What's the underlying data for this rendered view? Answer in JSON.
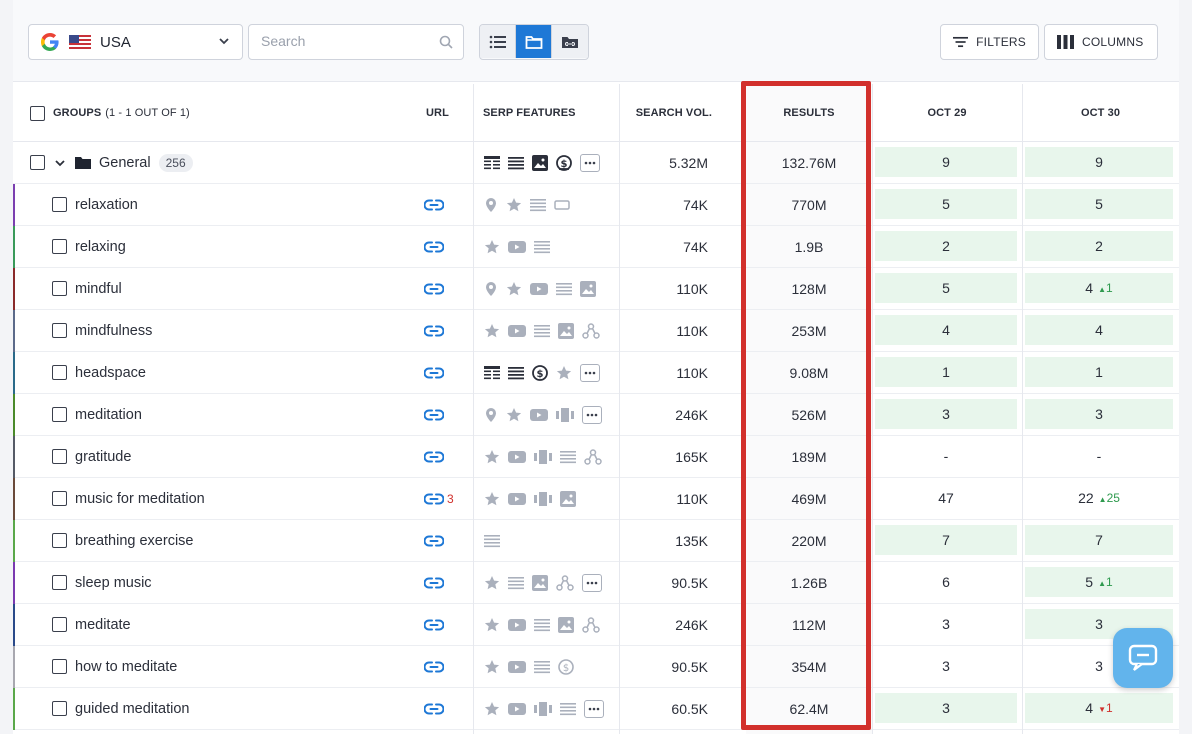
{
  "toolbar": {
    "country": "USA",
    "search_placeholder": "Search",
    "filters_label": "FILTERS",
    "columns_label": "COLUMNS"
  },
  "columns": {
    "groups": "GROUPS",
    "groups_count": "(1 - 1 OUT OF 1)",
    "url": "URL",
    "serp": "SERP FEATURES",
    "volume": "SEARCH VOL.",
    "results": "RESULTS",
    "date1": "OCT 29",
    "date2": "OCT 30"
  },
  "group": {
    "name": "General",
    "count": "256",
    "serp": [
      "table-icon",
      "list-icon",
      "image-icon",
      "dollar-icon",
      "more"
    ],
    "volume": "5.32M",
    "results": "132.76M",
    "oct29": "9",
    "oct30": "9"
  },
  "rows": [
    {
      "keyword": "relaxation",
      "stripe": "#7b3fb0",
      "url_count": "",
      "serp": [
        "pin",
        "star",
        "list",
        "box"
      ],
      "volume": "74K",
      "results": "770M",
      "oct29": "5",
      "oct30": "5",
      "oct30_delta": "",
      "oct30_dir": "",
      "g29": true,
      "g30": true
    },
    {
      "keyword": "relaxing",
      "stripe": "#3a9a5a",
      "url_count": "",
      "serp": [
        "star",
        "video",
        "list"
      ],
      "volume": "74K",
      "results": "1.9B",
      "oct29": "2",
      "oct30": "2",
      "oct30_delta": "",
      "oct30_dir": "",
      "g29": true,
      "g30": true
    },
    {
      "keyword": "mindful",
      "stripe": "#8a2a2a",
      "url_count": "",
      "serp": [
        "pin",
        "star",
        "video",
        "list",
        "image"
      ],
      "volume": "110K",
      "results": "128M",
      "oct29": "5",
      "oct30": "4",
      "oct30_delta": "1",
      "oct30_dir": "up",
      "g29": true,
      "g30": true
    },
    {
      "keyword": "mindfulness",
      "stripe": "#5c6a8a",
      "url_count": "",
      "serp": [
        "star",
        "video",
        "list",
        "image",
        "tree"
      ],
      "volume": "110K",
      "results": "253M",
      "oct29": "4",
      "oct30": "4",
      "oct30_delta": "",
      "oct30_dir": "",
      "g29": true,
      "g30": true
    },
    {
      "keyword": "headspace",
      "stripe": "#2a6a8a",
      "url_count": "",
      "serp": [
        "table-dark",
        "list-dark",
        "dollar-dark",
        "star",
        "more"
      ],
      "volume": "110K",
      "results": "9.08M",
      "oct29": "1",
      "oct30": "1",
      "oct30_delta": "",
      "oct30_dir": "",
      "g29": true,
      "g30": true
    },
    {
      "keyword": "meditation",
      "stripe": "#4a8a2a",
      "url_count": "",
      "serp": [
        "pin",
        "star",
        "video",
        "carousel",
        "more"
      ],
      "volume": "246K",
      "results": "526M",
      "oct29": "3",
      "oct30": "3",
      "oct30_delta": "",
      "oct30_dir": "",
      "g29": true,
      "g30": true
    },
    {
      "keyword": "gratitude",
      "stripe": "#555a66",
      "url_count": "",
      "serp": [
        "star",
        "video",
        "carousel",
        "list",
        "tree"
      ],
      "volume": "165K",
      "results": "189M",
      "oct29": "-",
      "oct30": "-",
      "oct30_delta": "",
      "oct30_dir": "",
      "g29": false,
      "g30": false
    },
    {
      "keyword": "music for meditation",
      "stripe": "#6a4a3a",
      "url_count": "3",
      "serp": [
        "star",
        "video",
        "carousel",
        "image"
      ],
      "volume": "110K",
      "results": "469M",
      "oct29": "47",
      "oct30": "22",
      "oct30_delta": "25",
      "oct30_dir": "up",
      "g29": false,
      "g30": false
    },
    {
      "keyword": "breathing exercise",
      "stripe": "#5aa84a",
      "url_count": "",
      "serp": [
        "list"
      ],
      "volume": "135K",
      "results": "220M",
      "oct29": "7",
      "oct30": "7",
      "oct30_delta": "",
      "oct30_dir": "",
      "g29": true,
      "g30": true
    },
    {
      "keyword": "sleep music",
      "stripe": "#7a3ab0",
      "url_count": "",
      "serp": [
        "star",
        "list",
        "image",
        "tree",
        "more"
      ],
      "volume": "90.5K",
      "results": "1.26B",
      "oct29": "6",
      "oct30": "5",
      "oct30_delta": "1",
      "oct30_dir": "up",
      "g29": false,
      "g30": true
    },
    {
      "keyword": "meditate",
      "stripe": "#2a4a8a",
      "url_count": "",
      "serp": [
        "star",
        "video",
        "list",
        "image",
        "tree"
      ],
      "volume": "246K",
      "results": "112M",
      "oct29": "3",
      "oct30": "3",
      "oct30_delta": "",
      "oct30_dir": "",
      "g29": false,
      "g30": true
    },
    {
      "keyword": "how to meditate",
      "stripe": "#a8a8b0",
      "url_count": "",
      "serp": [
        "star",
        "video",
        "list",
        "dollar"
      ],
      "volume": "90.5K",
      "results": "354M",
      "oct29": "3",
      "oct30": "3",
      "oct30_delta": "",
      "oct30_dir": "",
      "g29": false,
      "g30": false
    },
    {
      "keyword": "guided meditation",
      "stripe": "#5aa84a",
      "url_count": "",
      "serp": [
        "star",
        "video",
        "carousel",
        "list",
        "more"
      ],
      "volume": "60.5K",
      "results": "62.4M",
      "oct29": "3",
      "oct30": "4",
      "oct30_delta": "1",
      "oct30_dir": "down",
      "g29": true,
      "g30": true
    }
  ]
}
